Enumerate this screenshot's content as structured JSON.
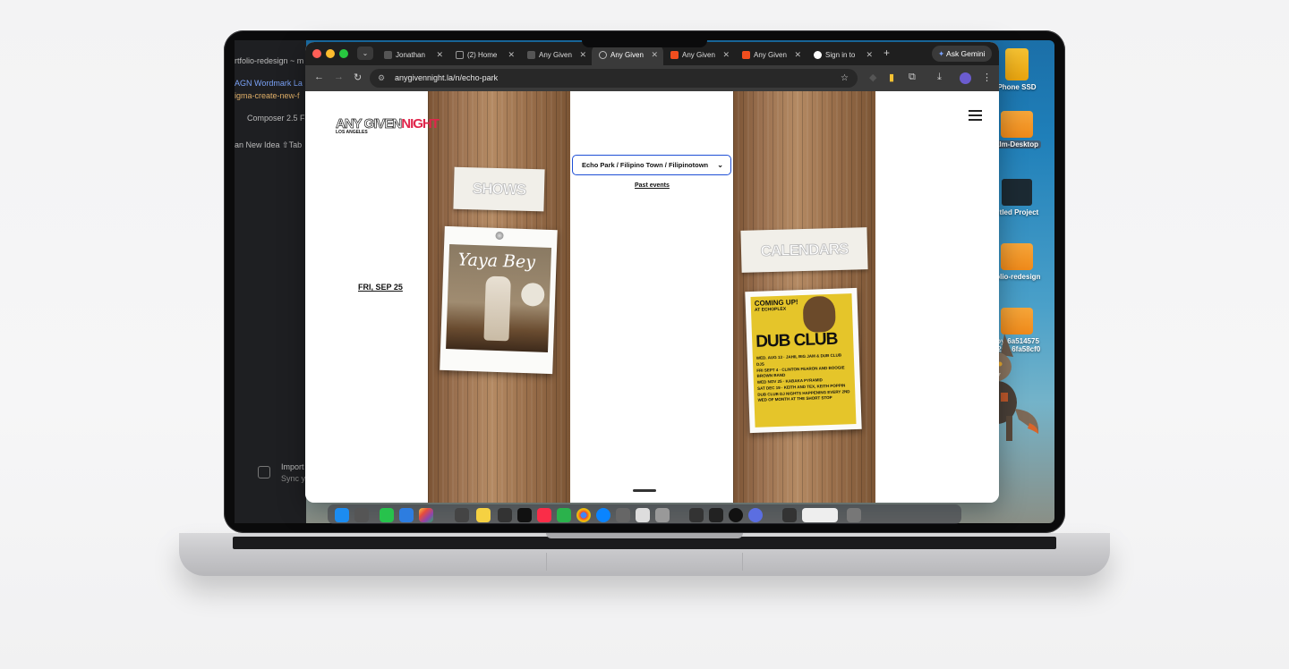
{
  "editor": {
    "lines": [
      "rtfolio-redesign ~ m",
      "AGN Wordmark La",
      "igma-create-new-f",
      "Composer 2.5 Fa",
      "an New Idea  ⇧Tab",
      "Import",
      "Sync y"
    ]
  },
  "desktop": {
    "items": [
      {
        "label": "Phone SSD"
      },
      {
        "label": "alm-Desktop"
      },
      {
        "label": "titled Project"
      },
      {
        "label": "folio-redesign"
      },
      {
        "label": "loy-6a514575"
      },
      {
        "label": "c2d...6fa58cf0"
      }
    ]
  },
  "browser": {
    "tabs": [
      {
        "label": "Jonathan",
        "color": "#6b7280"
      },
      {
        "label": "(2) Home",
        "color": "#9ca3af"
      },
      {
        "label": "Any Given",
        "color": "#6b7280"
      },
      {
        "label": "Any Given",
        "color": "#9ca3af"
      },
      {
        "label": "Any Given",
        "color": "#f24e1e"
      },
      {
        "label": "Any Given",
        "color": "#f24e1e"
      },
      {
        "label": "Sign in to",
        "color": "#ffffff"
      }
    ],
    "new_tab": "+",
    "ask_gemini": "Ask Gemini",
    "url": "anygivennight.la/n/echo-park"
  },
  "site": {
    "logo": {
      "part1": "ANY GIVEN",
      "part2": "NIGHT",
      "sub": "LOS ANGELES"
    },
    "neighborhood_select": "Echo Park / Filipino Town / Filipinotown",
    "past_events": "Past events",
    "shows_label": "SHOWS",
    "calendars_label": "CALENDARS",
    "event_date": "FRI, SEP 25",
    "poster1": {
      "title": "Yaya Bey"
    },
    "poster2": {
      "lines": [
        "COMING UP!",
        "AT ECHOPLEX",
        "DUB CLUB",
        "WED. AUG 13 · JAHIL BIG JAM & DUB CLUB DJS",
        "FRI SEPT 4 · CLINTON FEARON AND BOOGIE BROWN BAND",
        "WED NOV 25 · KABAKA PYRAMID",
        "SAT DEC 19 · KEITH AND TEX, KEITH POPPIN",
        "DUB CLUB DJ NIGHTS HAPPENING EVERY 2ND WED OF MONTH AT THE SHORT STOP"
      ]
    }
  },
  "colors": {
    "accent": "#e0264b",
    "select_border": "#1e4fd6"
  }
}
